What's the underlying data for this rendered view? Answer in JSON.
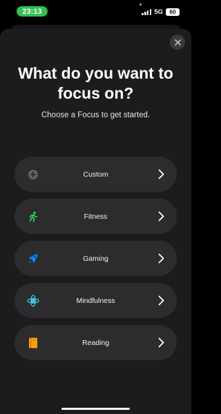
{
  "status": {
    "time": "23:13",
    "network": "5G",
    "battery": "60"
  },
  "title": "What do you want to focus on?",
  "subtitle": "Choose a Focus to get started.",
  "options": [
    {
      "label": "Custom",
      "icon": "plus-circle-icon",
      "color": "#8e8e93"
    },
    {
      "label": "Fitness",
      "icon": "running-figure-icon",
      "color": "#30d158"
    },
    {
      "label": "Gaming",
      "icon": "rocket-icon",
      "color": "#0a84ff"
    },
    {
      "label": "Mindfulness",
      "icon": "flower-icon",
      "color": "#40c8e0"
    },
    {
      "label": "Reading",
      "icon": "book-icon",
      "color": "#ff9f0a"
    }
  ]
}
